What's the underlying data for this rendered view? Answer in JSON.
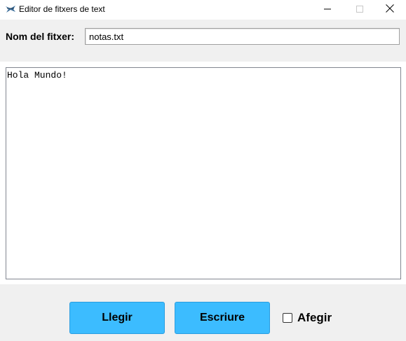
{
  "window": {
    "title": "Editor de fitxers de text"
  },
  "filename": {
    "label": "Nom del fitxer:",
    "value": "notas.txt"
  },
  "editor": {
    "content": "Hola Mundo!"
  },
  "actions": {
    "read_label": "Llegir",
    "write_label": "Escriure",
    "append_label": "Afegir",
    "append_checked": false
  },
  "colors": {
    "button_bg": "#3cbcff",
    "window_bg": "#f0f0f0"
  },
  "icons": {
    "app": "feather-icon",
    "minimize": "minimize-icon",
    "maximize": "maximize-icon",
    "close": "close-icon"
  }
}
